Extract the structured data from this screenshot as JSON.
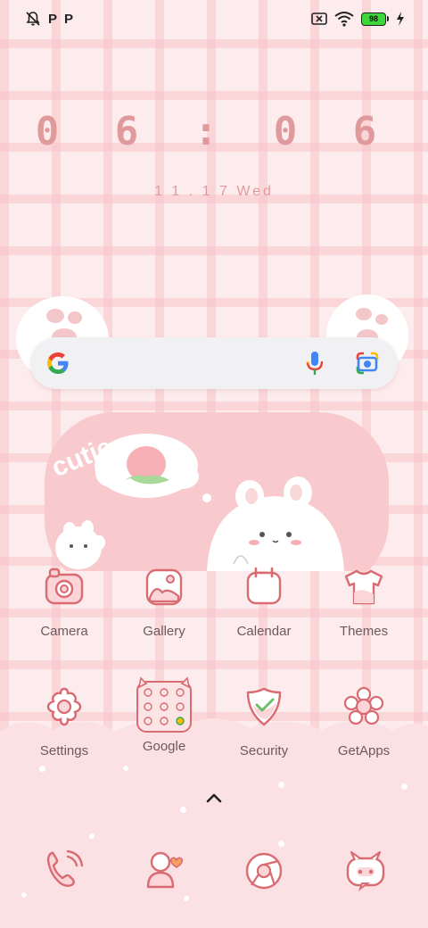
{
  "status_bar": {
    "left_letters": [
      "P",
      "P"
    ],
    "battery_level": "98"
  },
  "clock": {
    "time": "0 6 : 0 6",
    "date": "1 1 . 1 7  Wed"
  },
  "widget": {
    "word": "cutie"
  },
  "apps_row1": [
    {
      "label": "Camera",
      "icon": "camera-icon"
    },
    {
      "label": "Gallery",
      "icon": "gallery-icon"
    },
    {
      "label": "Calendar",
      "icon": "calendar-icon"
    },
    {
      "label": "Themes",
      "icon": "themes-icon"
    }
  ],
  "apps_row2": [
    {
      "label": "Settings",
      "icon": "settings-icon"
    },
    {
      "label": "Google",
      "icon": "google-folder-icon"
    },
    {
      "label": "Security",
      "icon": "security-icon"
    },
    {
      "label": "GetApps",
      "icon": "getapps-icon"
    }
  ],
  "dock": [
    {
      "icon": "phone-icon"
    },
    {
      "icon": "contacts-icon"
    },
    {
      "icon": "browser-icon"
    },
    {
      "icon": "messaging-icon"
    }
  ],
  "colors": {
    "accent": "#e19a9c",
    "line": "#d96b72",
    "background": "#fdeced"
  }
}
